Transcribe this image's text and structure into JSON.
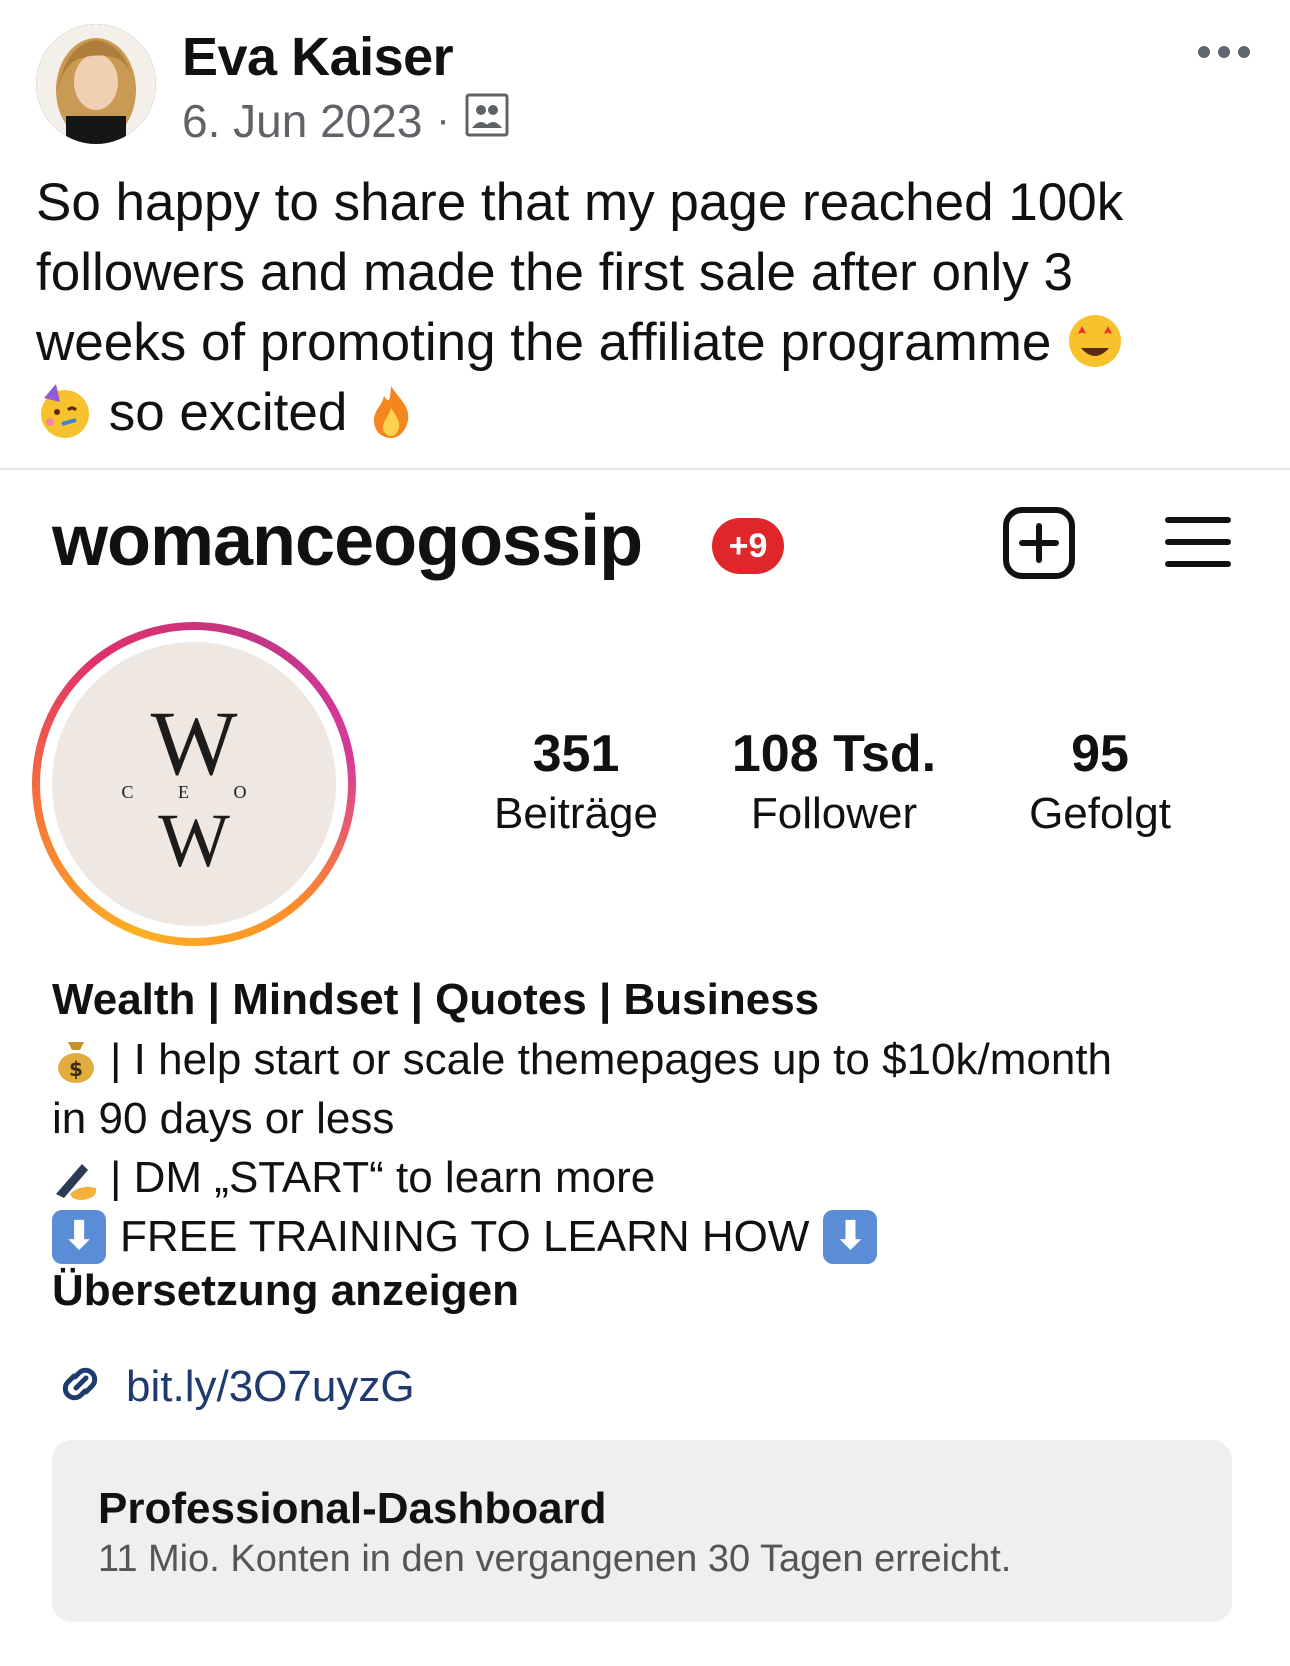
{
  "post": {
    "author": "Eva Kaiser",
    "date": "6. Jun 2023",
    "separator": "·",
    "audience_icon": "contacts-icon",
    "more_icon": "more-options-icon",
    "text_line1": "So happy to share that my page reached 100k",
    "text_line2": "followers and made the first sale after only 3",
    "text_line3": "weeks of promoting the affiliate programme",
    "text_line4": "so excited",
    "emojis": [
      "star-struck-emoji",
      "partying-face-emoji",
      "fire-emoji"
    ]
  },
  "profile": {
    "username": "womanceogossip",
    "notification_badge": "+9",
    "logo_text_top": "W",
    "logo_text_mid": "C E O",
    "logo_text_bottom": "W",
    "stats": [
      {
        "value": "351",
        "label": "Beiträge"
      },
      {
        "value": "108 Tsd.",
        "label": "Follower"
      },
      {
        "value": "95",
        "label": "Gefolgt"
      }
    ],
    "bio": {
      "title": "Wealth | Mindset | Quotes | Business",
      "line1": "| I help start or scale themepages up to $10k/month",
      "line2": "in 90 days or less",
      "line3": "| DM „START“ to learn more",
      "line4": "FREE TRAINING TO LEARN HOW",
      "translate": "Übersetzung anzeigen"
    },
    "link": "bit.ly/3O7uyzG",
    "dashboard": {
      "title": "Professional-Dashboard",
      "subtitle": "11 Mio. Konten in den vergangenen 30 Tagen erreicht."
    }
  },
  "colors": {
    "badge": "#e0252b",
    "link": "#1f3a6e",
    "meta_gray": "#5f6368",
    "dashboard_bg": "#efefef"
  }
}
